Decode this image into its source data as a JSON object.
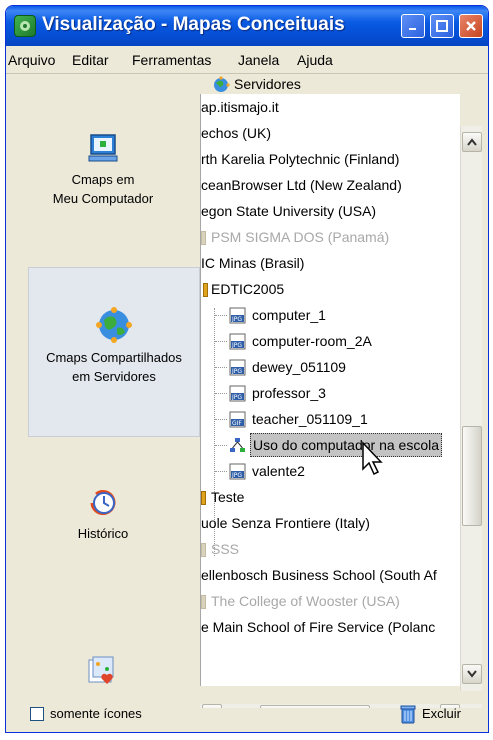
{
  "window": {
    "title": "Visualização - Mapas Conceituais",
    "accent": "#0a58ea"
  },
  "menu": [
    "Arquivo",
    "Editar",
    "Ferramentas",
    "Janela",
    "Ajuda"
  ],
  "sidebar": {
    "items": [
      {
        "label_line1": "Cmaps em",
        "label_line2": "Meu Computador",
        "icon": "computer-icon"
      },
      {
        "label_line1": "Cmaps Compartilhados",
        "label_line2": "em Servidores",
        "icon": "network-globe-icon",
        "selected": true
      },
      {
        "label_line1": "Histórico",
        "label_line2": "",
        "icon": "history-clock-icon"
      },
      {
        "label_line1": "",
        "label_line2": "",
        "icon": "favorites-icon"
      }
    ]
  },
  "tree": {
    "header": "Servidores",
    "rows": [
      {
        "text": "ap.itismajo.it",
        "dim": false
      },
      {
        "text": "echos (UK)",
        "dim": false
      },
      {
        "text": "rth Karelia Polytechnic (Finland)",
        "dim": false
      },
      {
        "text": "ceanBrowser Ltd (New Zealand)",
        "dim": false
      },
      {
        "text": "egon State University (USA)",
        "dim": false
      },
      {
        "text": "PSM SIGMA DOS (Panamá)",
        "dim": true
      },
      {
        "text": "IC Minas (Brasil)",
        "dim": false
      },
      {
        "text": "EDTIC2005",
        "dim": false
      },
      {
        "text": "computer_1",
        "dim": false,
        "icon": "jpg-file-icon"
      },
      {
        "text": "computer-room_2A",
        "dim": false,
        "icon": "jpg-file-icon"
      },
      {
        "text": "dewey_051109",
        "dim": false,
        "icon": "jpg-file-icon"
      },
      {
        "text": "professor_3",
        "dim": false,
        "icon": "jpg-file-icon"
      },
      {
        "text": "teacher_051109_1",
        "dim": false,
        "icon": "gif-file-icon"
      },
      {
        "text": "Uso do computador na escola",
        "dim": false,
        "icon": "cmap-icon",
        "selected": true
      },
      {
        "text": "valente2",
        "dim": false,
        "icon": "jpg-file-icon"
      },
      {
        "text": "Teste",
        "dim": false
      },
      {
        "text": "uole Senza Frontiere (Italy)",
        "dim": false
      },
      {
        "text": "SSS",
        "dim": true
      },
      {
        "text": "ellenbosch Business School (South Af",
        "dim": false
      },
      {
        "text": "The College of Wooster (USA)",
        "dim": true
      },
      {
        "text": "e Main School of Fire Service (Polanc",
        "dim": false
      }
    ]
  },
  "status": {
    "checkbox_label": "somente ícones",
    "delete_label": "Excluir"
  }
}
